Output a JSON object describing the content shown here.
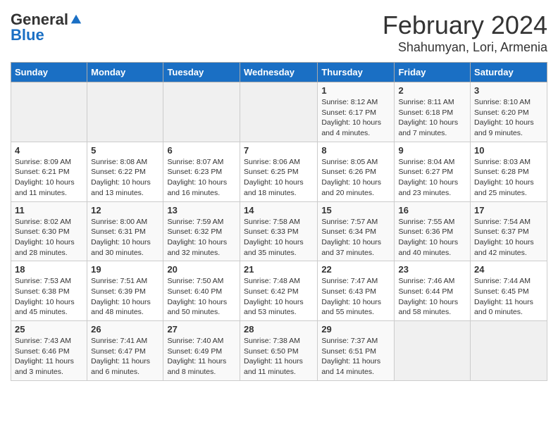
{
  "header": {
    "logo_general": "General",
    "logo_blue": "Blue",
    "month_title": "February 2024",
    "location": "Shahumyan, Lori, Armenia"
  },
  "days_of_week": [
    "Sunday",
    "Monday",
    "Tuesday",
    "Wednesday",
    "Thursday",
    "Friday",
    "Saturday"
  ],
  "weeks": [
    [
      {
        "day": "",
        "info": ""
      },
      {
        "day": "",
        "info": ""
      },
      {
        "day": "",
        "info": ""
      },
      {
        "day": "",
        "info": ""
      },
      {
        "day": "1",
        "info": "Sunrise: 8:12 AM\nSunset: 6:17 PM\nDaylight: 10 hours\nand 4 minutes."
      },
      {
        "day": "2",
        "info": "Sunrise: 8:11 AM\nSunset: 6:18 PM\nDaylight: 10 hours\nand 7 minutes."
      },
      {
        "day": "3",
        "info": "Sunrise: 8:10 AM\nSunset: 6:20 PM\nDaylight: 10 hours\nand 9 minutes."
      }
    ],
    [
      {
        "day": "4",
        "info": "Sunrise: 8:09 AM\nSunset: 6:21 PM\nDaylight: 10 hours\nand 11 minutes."
      },
      {
        "day": "5",
        "info": "Sunrise: 8:08 AM\nSunset: 6:22 PM\nDaylight: 10 hours\nand 13 minutes."
      },
      {
        "day": "6",
        "info": "Sunrise: 8:07 AM\nSunset: 6:23 PM\nDaylight: 10 hours\nand 16 minutes."
      },
      {
        "day": "7",
        "info": "Sunrise: 8:06 AM\nSunset: 6:25 PM\nDaylight: 10 hours\nand 18 minutes."
      },
      {
        "day": "8",
        "info": "Sunrise: 8:05 AM\nSunset: 6:26 PM\nDaylight: 10 hours\nand 20 minutes."
      },
      {
        "day": "9",
        "info": "Sunrise: 8:04 AM\nSunset: 6:27 PM\nDaylight: 10 hours\nand 23 minutes."
      },
      {
        "day": "10",
        "info": "Sunrise: 8:03 AM\nSunset: 6:28 PM\nDaylight: 10 hours\nand 25 minutes."
      }
    ],
    [
      {
        "day": "11",
        "info": "Sunrise: 8:02 AM\nSunset: 6:30 PM\nDaylight: 10 hours\nand 28 minutes."
      },
      {
        "day": "12",
        "info": "Sunrise: 8:00 AM\nSunset: 6:31 PM\nDaylight: 10 hours\nand 30 minutes."
      },
      {
        "day": "13",
        "info": "Sunrise: 7:59 AM\nSunset: 6:32 PM\nDaylight: 10 hours\nand 32 minutes."
      },
      {
        "day": "14",
        "info": "Sunrise: 7:58 AM\nSunset: 6:33 PM\nDaylight: 10 hours\nand 35 minutes."
      },
      {
        "day": "15",
        "info": "Sunrise: 7:57 AM\nSunset: 6:34 PM\nDaylight: 10 hours\nand 37 minutes."
      },
      {
        "day": "16",
        "info": "Sunrise: 7:55 AM\nSunset: 6:36 PM\nDaylight: 10 hours\nand 40 minutes."
      },
      {
        "day": "17",
        "info": "Sunrise: 7:54 AM\nSunset: 6:37 PM\nDaylight: 10 hours\nand 42 minutes."
      }
    ],
    [
      {
        "day": "18",
        "info": "Sunrise: 7:53 AM\nSunset: 6:38 PM\nDaylight: 10 hours\nand 45 minutes."
      },
      {
        "day": "19",
        "info": "Sunrise: 7:51 AM\nSunset: 6:39 PM\nDaylight: 10 hours\nand 48 minutes."
      },
      {
        "day": "20",
        "info": "Sunrise: 7:50 AM\nSunset: 6:40 PM\nDaylight: 10 hours\nand 50 minutes."
      },
      {
        "day": "21",
        "info": "Sunrise: 7:48 AM\nSunset: 6:42 PM\nDaylight: 10 hours\nand 53 minutes."
      },
      {
        "day": "22",
        "info": "Sunrise: 7:47 AM\nSunset: 6:43 PM\nDaylight: 10 hours\nand 55 minutes."
      },
      {
        "day": "23",
        "info": "Sunrise: 7:46 AM\nSunset: 6:44 PM\nDaylight: 10 hours\nand 58 minutes."
      },
      {
        "day": "24",
        "info": "Sunrise: 7:44 AM\nSunset: 6:45 PM\nDaylight: 11 hours\nand 0 minutes."
      }
    ],
    [
      {
        "day": "25",
        "info": "Sunrise: 7:43 AM\nSunset: 6:46 PM\nDaylight: 11 hours\nand 3 minutes."
      },
      {
        "day": "26",
        "info": "Sunrise: 7:41 AM\nSunset: 6:47 PM\nDaylight: 11 hours\nand 6 minutes."
      },
      {
        "day": "27",
        "info": "Sunrise: 7:40 AM\nSunset: 6:49 PM\nDaylight: 11 hours\nand 8 minutes."
      },
      {
        "day": "28",
        "info": "Sunrise: 7:38 AM\nSunset: 6:50 PM\nDaylight: 11 hours\nand 11 minutes."
      },
      {
        "day": "29",
        "info": "Sunrise: 7:37 AM\nSunset: 6:51 PM\nDaylight: 11 hours\nand 14 minutes."
      },
      {
        "day": "",
        "info": ""
      },
      {
        "day": "",
        "info": ""
      }
    ]
  ]
}
